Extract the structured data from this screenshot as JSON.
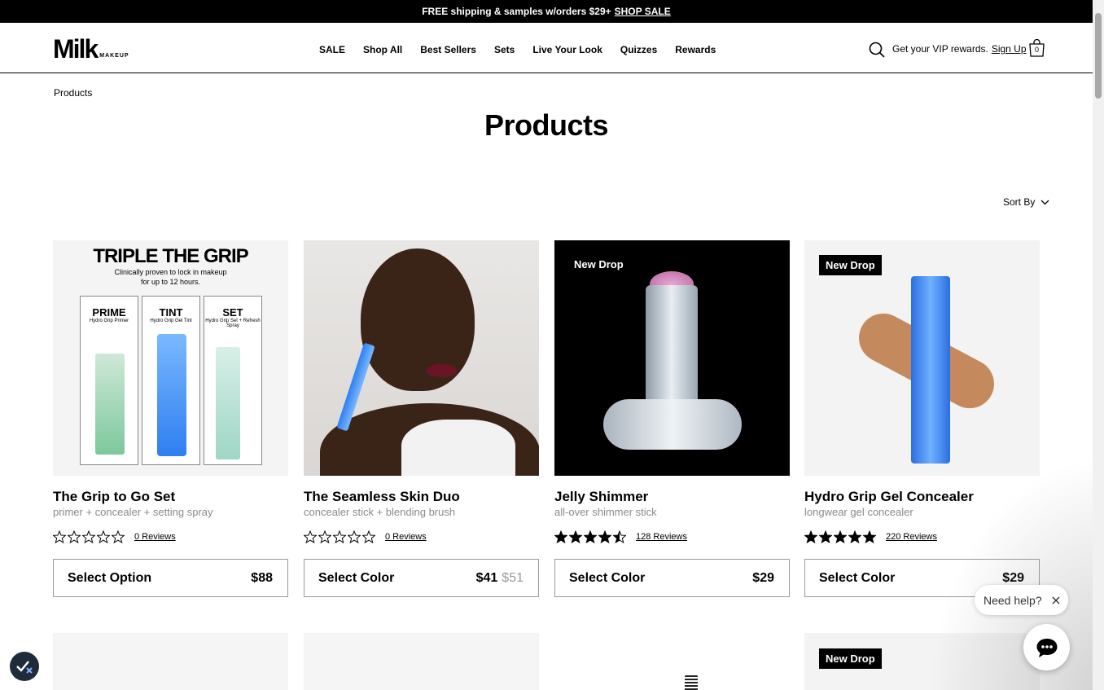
{
  "announcement": {
    "text": "FREE shipping & samples w/orders $29+",
    "link": "SHOP SALE"
  },
  "header": {
    "logo_main": "Milk",
    "logo_sub": "MAKEUP",
    "nav": [
      "SALE",
      "Shop All",
      "Best Sellers",
      "Sets",
      "Live Your Look",
      "Quizzes",
      "Rewards"
    ],
    "vip_text": "Get your VIP rewards.",
    "vip_link": "Sign Up",
    "cart_count": "0"
  },
  "breadcrumb": "Products",
  "page_title": "Products",
  "sort_label": "Sort By",
  "products": [
    {
      "name": "The Grip to Go Set",
      "subtitle": "primer + concealer + setting spray",
      "rating": 0,
      "reviews": "0 Reviews",
      "select_label": "Select Option",
      "price": "$88",
      "old_price": "",
      "badge": "",
      "image_text": {
        "headline": "TRIPLE THE GRIP",
        "caption": "Clinically proven to lock in makeup for up to 12 hours.",
        "panels": [
          {
            "title": "PRIME",
            "sub": "Hydro Grip Primer"
          },
          {
            "title": "TINT",
            "sub": "Hydro Grip Gel Tint"
          },
          {
            "title": "SET",
            "sub": "Hydro Grip Set + Refresh Spray"
          }
        ]
      }
    },
    {
      "name": "The Seamless Skin Duo",
      "subtitle": "concealer stick + blending brush",
      "rating": 0,
      "reviews": "0 Reviews",
      "select_label": "Select Color",
      "price": "$41",
      "old_price": "$51",
      "badge": ""
    },
    {
      "name": "Jelly Shimmer",
      "subtitle": "all-over shimmer stick",
      "rating": 4.5,
      "reviews": "128 Reviews",
      "select_label": "Select Color",
      "price": "$29",
      "old_price": "",
      "badge": "New Drop"
    },
    {
      "name": "Hydro Grip Gel Concealer",
      "subtitle": "longwear gel concealer",
      "rating": 5,
      "reviews": "220 Reviews",
      "select_label": "Select Color",
      "price": "$29",
      "old_price": "",
      "badge": "New Drop"
    }
  ],
  "row2_badge": "New Drop",
  "chat": {
    "need_help": "Need help?"
  },
  "colors": {
    "accent": "#000000",
    "product_blue": "#2f7ff0",
    "card_bg": "#f5f5f5"
  }
}
